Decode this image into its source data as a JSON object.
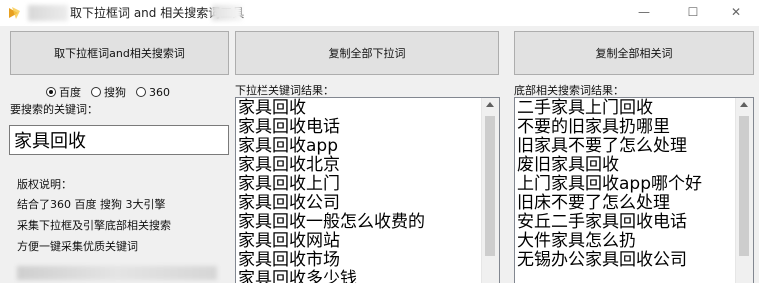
{
  "window": {
    "title": "取下拉框词 and 相关搜索词工具",
    "controls": {
      "minimize": "—",
      "maximize": "☐",
      "close": "✕"
    }
  },
  "buttons": {
    "fetch": "取下拉框词and相关搜索词",
    "copy_dropdown": "复制全部下拉词",
    "copy_related": "复制全部相关词"
  },
  "engines": {
    "options": [
      "百度",
      "搜狗",
      "360"
    ],
    "selected": "百度"
  },
  "keyword": {
    "label": "要搜索的关键词：",
    "value": "家具回收"
  },
  "copyright": {
    "title": "版权说明：",
    "lines": [
      "结合了360 百度 搜狗   3大引擎",
      "采集下拉框及引擎底部相关搜索",
      "方便一键采集优质关键词"
    ]
  },
  "dropdown_results": {
    "label": "下拉栏关键词结果：",
    "items": [
      "家具回收",
      "家具回收电话",
      "家具回收app",
      "家具回收北京",
      "家具回收上门",
      "家具回收公司",
      "家具回收一般怎么收费的",
      "家具回收网站",
      "家具回收市场",
      "家具回收多少钱"
    ]
  },
  "related_results": {
    "label": "底部相关搜索词结果：",
    "items": [
      "二手家具上门回收",
      "不要的旧家具扔哪里",
      "旧家具不要了怎么处理",
      "废旧家具回收",
      "上门家具回收app哪个好",
      "旧床不要了怎么处理",
      "安丘二手家具回收电话",
      "大件家具怎么扔",
      "无锡办公家具回收公司"
    ]
  },
  "colors": {
    "window_bg": "#f0f0f0",
    "button_bg": "#e1e1e1",
    "button_border": "#adadad",
    "textarea_border": "#828790"
  }
}
